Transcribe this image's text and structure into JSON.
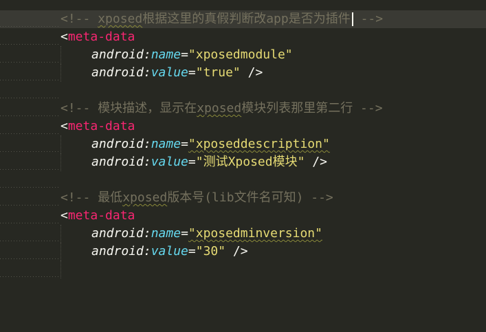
{
  "lines": {
    "l1": {
      "open": "<!-- ",
      "wavy": "xposed",
      "rest": "根据这里的真假判断改app是否为插件",
      "close": " -->"
    },
    "l2": {
      "lt": "<",
      "tag": "meta-data"
    },
    "l3": {
      "ns": "android",
      "colon": ":",
      "attr": "name",
      "eq": "=",
      "value": "\"xposedmodule\""
    },
    "l4": {
      "ns": "android",
      "colon": ":",
      "attr": "value",
      "eq": "=",
      "value": "\"true\"",
      "end": " />"
    },
    "l6": {
      "open": "<!-- ",
      "pre": "模块描述，显示在",
      "wavy": "xposed",
      "rest": "模块列表那里第二行",
      "close": " -->"
    },
    "l7": {
      "lt": "<",
      "tag": "meta-data"
    },
    "l8": {
      "ns": "android",
      "colon": ":",
      "attr": "name",
      "eq": "=",
      "value": "\"xposeddescription\""
    },
    "l9": {
      "ns": "android",
      "colon": ":",
      "attr": "value",
      "eq": "=",
      "value": "\"测试Xposed模块\"",
      "end": " />"
    },
    "l11": {
      "open": "<!-- ",
      "pre": "最低",
      "wavy": "xposed",
      "rest": "版本号(lib文件名可知)",
      "close": " -->"
    },
    "l12": {
      "lt": "<",
      "tag": "meta-data"
    },
    "l13": {
      "ns": "android",
      "colon": ":",
      "attr": "name",
      "eq": "=",
      "value": "\"xposedminversion\""
    },
    "l14": {
      "ns": "android",
      "colon": ":",
      "attr": "value",
      "eq": "=",
      "value": "\"30\"",
      "end": " />"
    }
  },
  "colors": {
    "background": "#272822",
    "comment": "#75715e",
    "tag": "#f92672",
    "namespace": "#66d9ef",
    "string": "#e6db74",
    "text": "#f8f8f2"
  }
}
